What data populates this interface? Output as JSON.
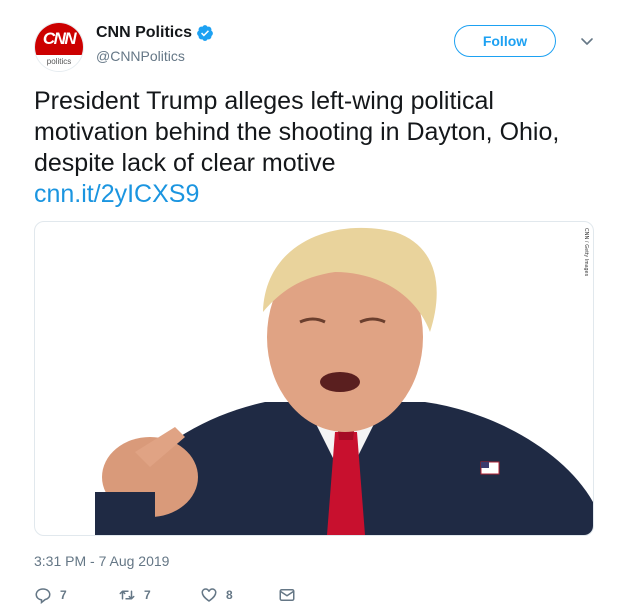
{
  "account": {
    "display_name": "CNN Politics",
    "handle": "@CNNPolitics",
    "avatar_logo": "CNN",
    "avatar_sub": "politics",
    "verified": true
  },
  "follow_label": "Follow",
  "tweet": {
    "text": "President Trump alleges left-wing political motivation behind the shooting in Dayton, Ohio, despite lack of clear motive",
    "link": "cnn.it/2yICXS9"
  },
  "media": {
    "credit": "CNN / Getty Images"
  },
  "timestamp": "3:31 PM - 7 Aug 2019",
  "actions": {
    "replies": "7",
    "retweets": "7",
    "likes": "8"
  },
  "colors": {
    "accent": "#1da1f2",
    "link": "#1b95e0",
    "brand_red": "#cc0000",
    "muted": "#657786"
  },
  "icons": [
    "verified-badge-icon",
    "chevron-down-icon",
    "reply-icon",
    "retweet-icon",
    "like-icon",
    "direct-message-icon"
  ]
}
